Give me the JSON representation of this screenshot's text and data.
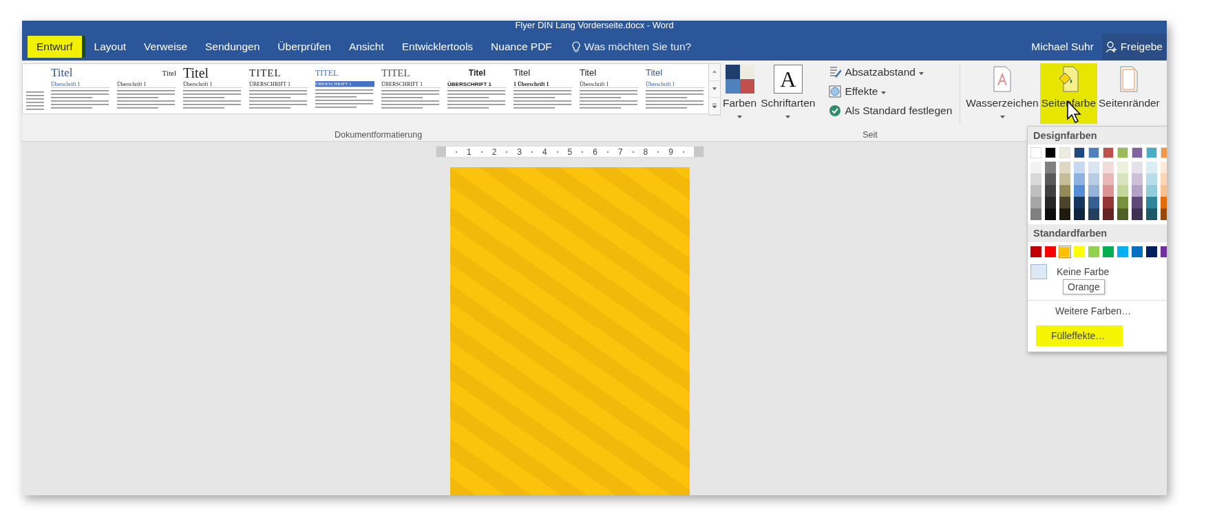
{
  "window": {
    "title": "Flyer DIN Lang Vorderseite.docx - Word"
  },
  "tabs": [
    {
      "label": "Entwurf",
      "selected": true
    },
    {
      "label": "Layout",
      "selected": false
    },
    {
      "label": "Verweise",
      "selected": false
    },
    {
      "label": "Sendungen",
      "selected": false
    },
    {
      "label": "Überprüfen",
      "selected": false
    },
    {
      "label": "Ansicht",
      "selected": false
    },
    {
      "label": "Entwicklertools",
      "selected": false
    },
    {
      "label": "Nuance PDF",
      "selected": false
    }
  ],
  "tell_me": {
    "label": "Was möchten Sie tun?"
  },
  "user": {
    "name": "Michael Suhr"
  },
  "share": {
    "label": "Freigebe"
  },
  "style_gallery": {
    "group_label": "Dokumentformatierung",
    "thumbnails": [
      {
        "kind": "partial"
      },
      {
        "kind": "blue",
        "title": "Titel",
        "heading": "Überschrift 1"
      },
      {
        "kind": "caps",
        "title": "Titel",
        "heading": "Überschrift 1"
      },
      {
        "kind": "classic",
        "title": "Titel",
        "heading": "Überschrift 1"
      },
      {
        "kind": "serif-caps",
        "title": "TITEL",
        "heading": "ÜBERSCHRIFT 1"
      },
      {
        "kind": "banded",
        "title": "TITEL",
        "heading": "ÜBERSCHRIFT 1"
      },
      {
        "kind": "gray-caps",
        "title": "TITEL",
        "heading": "ÜBERSCHRIFT 1"
      },
      {
        "kind": "bold",
        "title": "Titel",
        "heading": "ÜBERSCHRIFT 1"
      },
      {
        "kind": "numbered",
        "title": "Titel",
        "heading": "1 Überschrift 1"
      },
      {
        "kind": "plain",
        "title": "Titel",
        "heading": "Überschrift 1"
      },
      {
        "kind": "accent",
        "title": "Titel",
        "heading": "Überschrift 1"
      }
    ]
  },
  "design_buttons": [
    {
      "kind": "colors",
      "label": "Farben"
    },
    {
      "kind": "fonts",
      "label": "Schriftarten",
      "glyph": "A"
    }
  ],
  "design_options": [
    {
      "kind": "spacing",
      "label": "Absatzabstand",
      "dropdown": true
    },
    {
      "kind": "effects",
      "label": "Effekte",
      "dropdown": true
    },
    {
      "kind": "default",
      "label": "Als Standard festlegen",
      "dropdown": false
    }
  ],
  "page_background": {
    "group_label": "Seit",
    "buttons": [
      {
        "kind": "watermark",
        "label": "Wasserzeichen",
        "dropdown": true,
        "highlighted": false
      },
      {
        "kind": "page-color",
        "label": "Seitenfarbe",
        "dropdown": true,
        "highlighted": true
      },
      {
        "kind": "borders",
        "label": "Seitenränder",
        "dropdown": false,
        "highlighted": false
      }
    ]
  },
  "ruler": {
    "numbers": [
      "1",
      "2",
      "3",
      "4",
      "5",
      "6",
      "7",
      "8",
      "9"
    ]
  },
  "color_menu": {
    "theme_heading": "Designfarben",
    "theme_colors": [
      {
        "color": "#ffffff",
        "shades": [
          {
            "color": "#f2f2f2"
          },
          {
            "color": "#d9d9d9"
          },
          {
            "color": "#bfbfbf"
          },
          {
            "color": "#a6a6a6"
          },
          {
            "color": "#808080"
          }
        ]
      },
      {
        "color": "#000000",
        "shades": [
          {
            "color": "#808080"
          },
          {
            "color": "#595959"
          },
          {
            "color": "#404040"
          },
          {
            "color": "#262626"
          },
          {
            "color": "#0d0d0d"
          }
        ]
      },
      {
        "color": "#eeece1",
        "shades": [
          {
            "color": "#ddd9c3"
          },
          {
            "color": "#c4bd97"
          },
          {
            "color": "#948a54"
          },
          {
            "color": "#4a452a"
          },
          {
            "color": "#1d1b11"
          }
        ]
      },
      {
        "color": "#1f497d",
        "shades": [
          {
            "color": "#c6d9f0"
          },
          {
            "color": "#8db3e2"
          },
          {
            "color": "#548dd4"
          },
          {
            "color": "#17365d"
          },
          {
            "color": "#0f243e"
          }
        ]
      },
      {
        "color": "#4f81bd",
        "shades": [
          {
            "color": "#dbe5f1"
          },
          {
            "color": "#b8cce4"
          },
          {
            "color": "#95b3d7"
          },
          {
            "color": "#366092"
          },
          {
            "color": "#244061"
          }
        ]
      },
      {
        "color": "#c0504d",
        "shades": [
          {
            "color": "#f2dcdb"
          },
          {
            "color": "#e5b9b7"
          },
          {
            "color": "#d99694"
          },
          {
            "color": "#953734"
          },
          {
            "color": "#632423"
          }
        ]
      },
      {
        "color": "#9bbb59",
        "shades": [
          {
            "color": "#ebf1dd"
          },
          {
            "color": "#d7e3bc"
          },
          {
            "color": "#c3d69b"
          },
          {
            "color": "#76923c"
          },
          {
            "color": "#4f6128"
          }
        ]
      },
      {
        "color": "#8064a2",
        "shades": [
          {
            "color": "#e5e0ec"
          },
          {
            "color": "#ccc1d9"
          },
          {
            "color": "#b2a2c7"
          },
          {
            "color": "#5f497a"
          },
          {
            "color": "#3f3151"
          }
        ]
      },
      {
        "color": "#4bacc6",
        "shades": [
          {
            "color": "#dbeef3"
          },
          {
            "color": "#b7dde8"
          },
          {
            "color": "#92cddc"
          },
          {
            "color": "#31859b"
          },
          {
            "color": "#205867"
          }
        ]
      },
      {
        "color": "#f79646",
        "shades": [
          {
            "color": "#fdeada"
          },
          {
            "color": "#fbd5b5"
          },
          {
            "color": "#fac08f"
          },
          {
            "color": "#e36c09"
          },
          {
            "color": "#974806"
          }
        ]
      }
    ],
    "standard_heading": "Standardfarben",
    "standard_colors": [
      {
        "color": "#c00000",
        "selected": false
      },
      {
        "color": "#ff0000",
        "selected": false
      },
      {
        "color": "#ffc000",
        "selected": true
      },
      {
        "color": "#ffff00",
        "selected": false
      },
      {
        "color": "#92d050",
        "selected": false
      },
      {
        "color": "#00b050",
        "selected": false
      },
      {
        "color": "#00b0f0",
        "selected": false
      },
      {
        "color": "#0070c0",
        "selected": false
      },
      {
        "color": "#002060",
        "selected": false
      },
      {
        "color": "#7030a0",
        "selected": false
      }
    ],
    "no_color": {
      "label": "Keine Farbe"
    },
    "items": [
      {
        "label": "Weitere Farben…",
        "highlighted": false
      },
      {
        "label": "Fülleffekte…",
        "highlighted": true
      }
    ],
    "tooltip": "Orange"
  }
}
